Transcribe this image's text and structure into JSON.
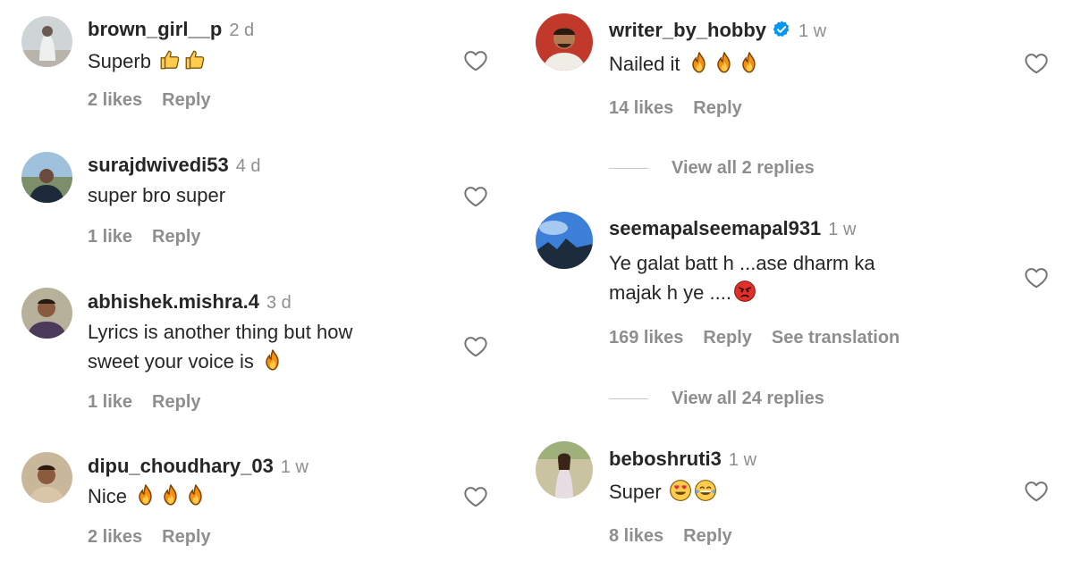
{
  "colors": {
    "text": "#262626",
    "muted": "#8e8e8e",
    "verified": "#0095f6",
    "divider": "#c7c7c7"
  },
  "left_comments": [
    {
      "username": "brown_girl__p",
      "time": "2 d",
      "text": "Superb",
      "emoji": [
        "thumbs-up-icon",
        "thumbs-up-icon"
      ],
      "likes": "2 likes",
      "reply": "Reply"
    },
    {
      "username": "surajdwivedi53",
      "time": "4 d",
      "text": "super bro super",
      "emoji": [],
      "likes": "1 like",
      "reply": "Reply"
    },
    {
      "username": "abhishek.mishra.4",
      "time": "3 d",
      "text_line1": "Lyrics is another thing but how",
      "text_line2": "sweet your voice is",
      "emoji": [
        "fire-icon"
      ],
      "likes": "1 like",
      "reply": "Reply"
    },
    {
      "username": "dipu_choudhary_03",
      "time": "1 w",
      "text": "Nice",
      "emoji": [
        "fire-icon",
        "fire-icon",
        "fire-icon"
      ],
      "likes": "2 likes",
      "reply": "Reply"
    }
  ],
  "right_comments": [
    {
      "username": "writer_by_hobby",
      "verified": true,
      "time": "1 w",
      "text": "Nailed it",
      "emoji": [
        "fire-icon",
        "fire-icon",
        "fire-icon"
      ],
      "likes": "14 likes",
      "reply": "Reply",
      "view_replies": "View all 2 replies"
    },
    {
      "username": "seemapalseemapal931",
      "time": "1 w",
      "text_line1": "Ye galat batt h ...ase dharm ka",
      "text_line2": "majak h ye ....",
      "emoji": [
        "angry-face-icon"
      ],
      "likes": "169 likes",
      "reply": "Reply",
      "see_translation": "See translation",
      "view_replies": "View all 24 replies"
    },
    {
      "username": "beboshruti3",
      "time": "1 w",
      "text": "Super",
      "emoji": [
        "heart-eyes-face-icon",
        "tears-of-joy-face-icon"
      ],
      "likes": "8 likes",
      "reply": "Reply"
    }
  ]
}
